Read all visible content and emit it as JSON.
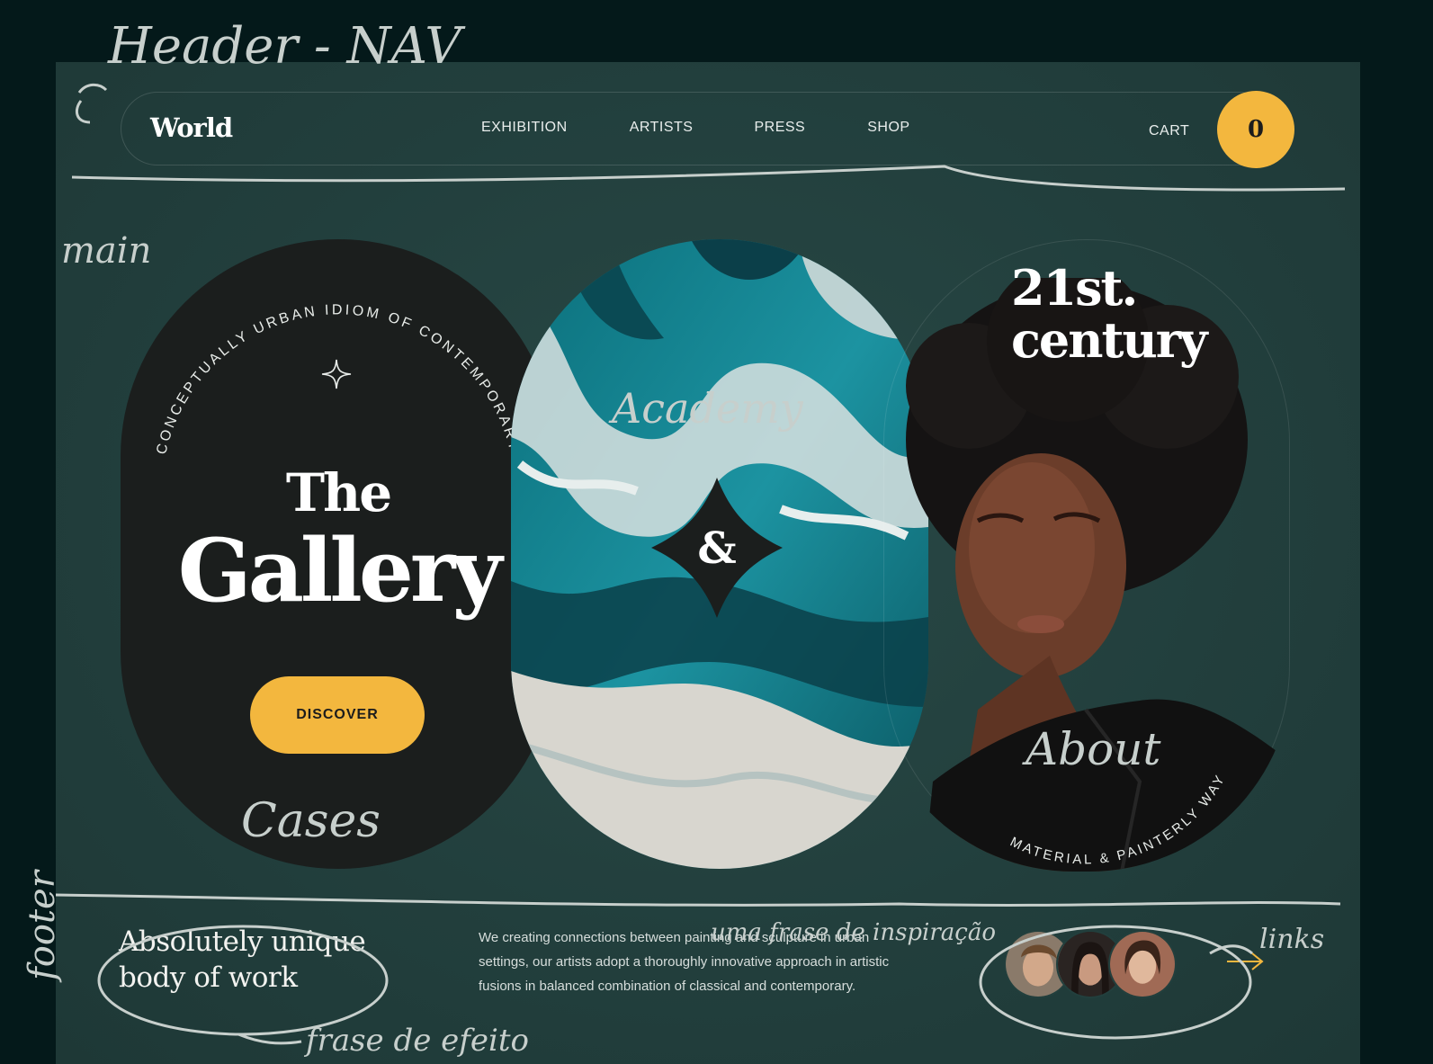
{
  "nav": {
    "logo": "World",
    "links": [
      "EXHIBITION",
      "ARTISTS",
      "PRESS",
      "SHOP"
    ],
    "cart_label": "CART",
    "cart_count": "0"
  },
  "hero": {
    "arc_text": "CONCEPTUALLY URBAN IDIOM OF CONTEMPORARY ART",
    "title_line1": "The",
    "title_line2": "Gallery",
    "cta_label": "DISCOVER",
    "ampersand": "&",
    "century_line1": "21st.",
    "century_line2": "century",
    "portrait_arc_text": "MATERIAL & PAINTERLY WAY"
  },
  "footer": {
    "tagline_line1": "Absolutely unique",
    "tagline_line2": "body of work",
    "blurb": "We creating connections between painting and sculpture in urban settings, our artists adopt a thoroughly innovative approach in artistic fusions in balanced combination of classical and contemporary."
  },
  "annotations": {
    "header": "Header - NAV",
    "main": "main",
    "footer": "footer",
    "academy": "Academy",
    "cases": "Cases",
    "about": "About",
    "phrase_inspiration": "uma frase de inspiração",
    "phrase_effect": "frase de efeito",
    "links": "links"
  },
  "colors": {
    "background": "#04191a",
    "page": "#223f3d",
    "accent": "#f3b73e",
    "dark_pill": "#1b1e1d"
  }
}
